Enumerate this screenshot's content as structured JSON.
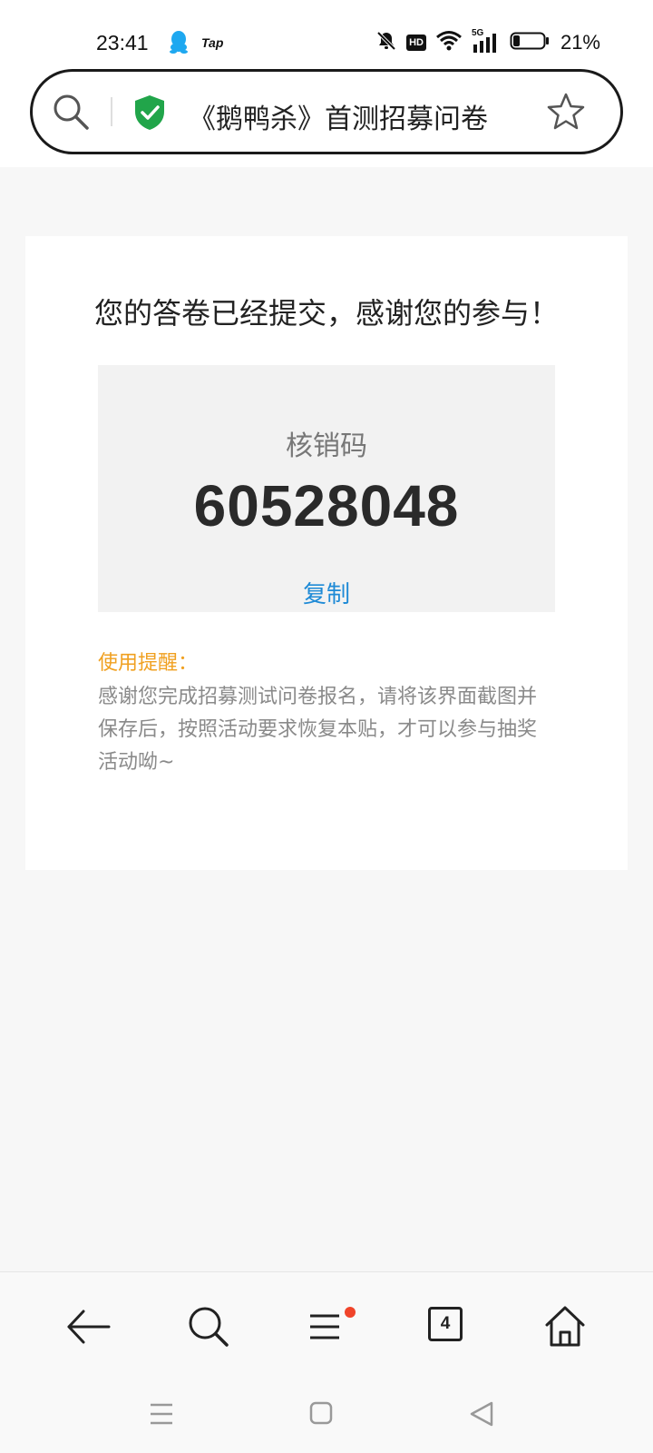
{
  "status_bar": {
    "time": "23:41",
    "tap_label": "Tap",
    "hd_label": "HD",
    "network_label": "5G",
    "battery_percent": "21%",
    "battery_level": 0.21,
    "icons": [
      "qq-penguin-icon",
      "tap-icon",
      "mute-bell-icon",
      "hd-icon",
      "wifi-icon",
      "cellular-5g-icon",
      "battery-icon"
    ]
  },
  "address_bar": {
    "title": "《鹅鸭杀》首测招募问卷",
    "icons": [
      "search-icon",
      "shield-check-icon",
      "star-icon"
    ]
  },
  "card": {
    "message": "您的答卷已经提交，感谢您的参与！",
    "code_label": "核销码",
    "code_value": "60528048",
    "copy_label": "复制",
    "tip_title": "使用提醒：",
    "tip_body": "感谢您完成招募测试问卷报名，请将该界面截图并保存后，按照活动要求恢复本贴，才可以参与抽奖活动呦~"
  },
  "toolbar": {
    "tab_count": "4",
    "icons": [
      "back-arrow-icon",
      "search-icon",
      "menu-icon",
      "tabs-icon",
      "home-icon"
    ]
  },
  "system_nav": {
    "icons": [
      "recent-apps-icon",
      "home-square-icon",
      "back-triangle-icon"
    ]
  },
  "colors": {
    "accent_link": "#1e8ad6",
    "tip_orange": "#f0a020",
    "shield_green": "#21a54a",
    "notification_dot": "#f0442a"
  }
}
